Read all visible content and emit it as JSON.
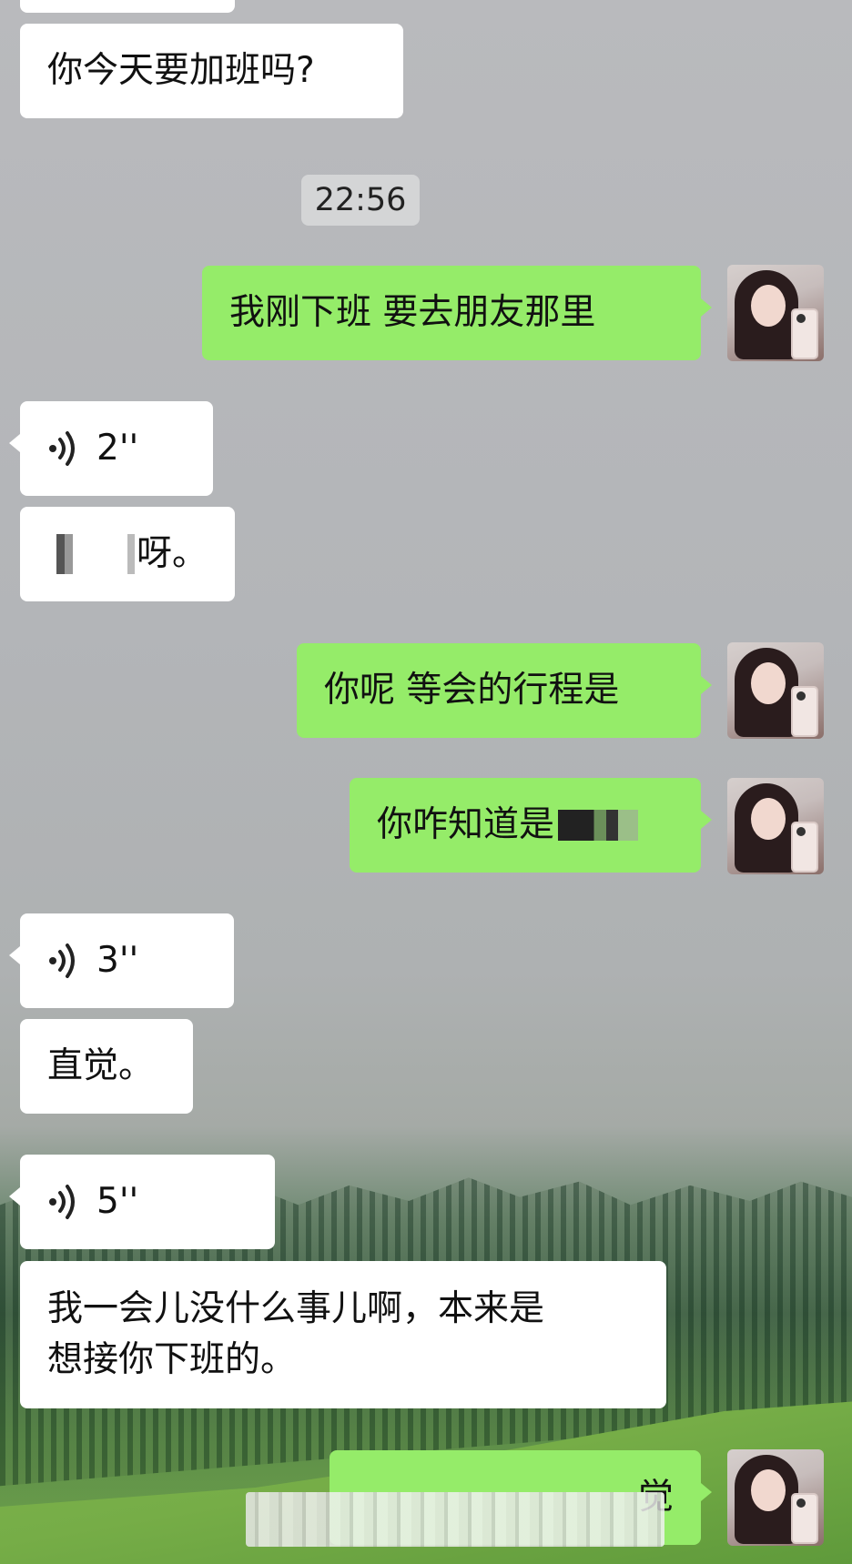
{
  "messages": {
    "m1": "你今天要加班吗?",
    "time1": "22:56",
    "m2": "我刚下班 要去朋友那里",
    "v1": "2''",
    "m3": "呀。",
    "m4": "你呢 等会的行程是",
    "m5": "你咋知道是",
    "v2": "3''",
    "m6": "直觉。",
    "v3": "5''",
    "m7_line1": "我一会儿没什么事儿啊，本来是",
    "m7_line2": "想接你下班的。",
    "m8": "觉"
  },
  "colors": {
    "self_bubble": "#95ec69",
    "other_bubble": "#ffffff",
    "timestamp_bg": "#d4d5d6"
  }
}
